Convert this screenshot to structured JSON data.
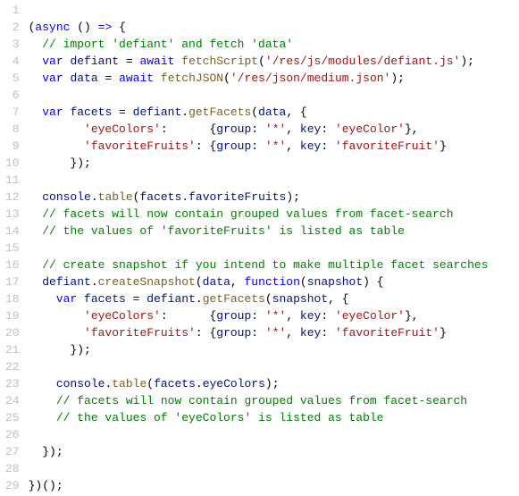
{
  "lines": [
    {
      "num": "1",
      "tokens": []
    },
    {
      "num": "2",
      "tokens": [
        {
          "cls": "pun",
          "t": "("
        },
        {
          "cls": "kw",
          "t": "async"
        },
        {
          "cls": "pun",
          "t": " () "
        },
        {
          "cls": "kw",
          "t": "=>"
        },
        {
          "cls": "pun",
          "t": " {"
        }
      ]
    },
    {
      "num": "3",
      "tokens": [
        {
          "cls": "pun",
          "t": "  "
        },
        {
          "cls": "com",
          "t": "// import 'defiant' and fetch 'data'"
        }
      ]
    },
    {
      "num": "4",
      "tokens": [
        {
          "cls": "pun",
          "t": "  "
        },
        {
          "cls": "kw",
          "t": "var"
        },
        {
          "cls": "pun",
          "t": " "
        },
        {
          "cls": "ident",
          "t": "defiant"
        },
        {
          "cls": "pun",
          "t": " = "
        },
        {
          "cls": "kw",
          "t": "await"
        },
        {
          "cls": "pun",
          "t": " "
        },
        {
          "cls": "fn",
          "t": "fetchScript"
        },
        {
          "cls": "pun",
          "t": "("
        },
        {
          "cls": "str",
          "t": "'/res/js/modules/defiant.js'"
        },
        {
          "cls": "pun",
          "t": ");"
        }
      ]
    },
    {
      "num": "5",
      "tokens": [
        {
          "cls": "pun",
          "t": "  "
        },
        {
          "cls": "kw",
          "t": "var"
        },
        {
          "cls": "pun",
          "t": " "
        },
        {
          "cls": "ident",
          "t": "data"
        },
        {
          "cls": "pun",
          "t": " = "
        },
        {
          "cls": "kw",
          "t": "await"
        },
        {
          "cls": "pun",
          "t": " "
        },
        {
          "cls": "fn",
          "t": "fetchJSON"
        },
        {
          "cls": "pun",
          "t": "("
        },
        {
          "cls": "str",
          "t": "'/res/json/medium.json'"
        },
        {
          "cls": "pun",
          "t": ");"
        }
      ]
    },
    {
      "num": "6",
      "tokens": []
    },
    {
      "num": "7",
      "tokens": [
        {
          "cls": "pun",
          "t": "  "
        },
        {
          "cls": "kw",
          "t": "var"
        },
        {
          "cls": "pun",
          "t": " "
        },
        {
          "cls": "ident",
          "t": "facets"
        },
        {
          "cls": "pun",
          "t": " = "
        },
        {
          "cls": "ident",
          "t": "defiant"
        },
        {
          "cls": "pun",
          "t": "."
        },
        {
          "cls": "fn",
          "t": "getFacets"
        },
        {
          "cls": "pun",
          "t": "("
        },
        {
          "cls": "ident",
          "t": "data"
        },
        {
          "cls": "pun",
          "t": ", {"
        }
      ]
    },
    {
      "num": "8",
      "tokens": [
        {
          "cls": "pun",
          "t": "        "
        },
        {
          "cls": "str",
          "t": "'eyeColors'"
        },
        {
          "cls": "pun",
          "t": ":      {"
        },
        {
          "cls": "prop",
          "t": "group"
        },
        {
          "cls": "pun",
          "t": ": "
        },
        {
          "cls": "str",
          "t": "'*'"
        },
        {
          "cls": "pun",
          "t": ", "
        },
        {
          "cls": "prop",
          "t": "key"
        },
        {
          "cls": "pun",
          "t": ": "
        },
        {
          "cls": "str",
          "t": "'eyeColor'"
        },
        {
          "cls": "pun",
          "t": "},"
        }
      ]
    },
    {
      "num": "9",
      "tokens": [
        {
          "cls": "pun",
          "t": "        "
        },
        {
          "cls": "str",
          "t": "'favoriteFruits'"
        },
        {
          "cls": "pun",
          "t": ": {"
        },
        {
          "cls": "prop",
          "t": "group"
        },
        {
          "cls": "pun",
          "t": ": "
        },
        {
          "cls": "str",
          "t": "'*'"
        },
        {
          "cls": "pun",
          "t": ", "
        },
        {
          "cls": "prop",
          "t": "key"
        },
        {
          "cls": "pun",
          "t": ": "
        },
        {
          "cls": "str",
          "t": "'favoriteFruit'"
        },
        {
          "cls": "pun",
          "t": "}"
        }
      ]
    },
    {
      "num": "10",
      "tokens": [
        {
          "cls": "pun",
          "t": "      });"
        }
      ]
    },
    {
      "num": "11",
      "tokens": []
    },
    {
      "num": "12",
      "tokens": [
        {
          "cls": "pun",
          "t": "  "
        },
        {
          "cls": "ident",
          "t": "console"
        },
        {
          "cls": "pun",
          "t": "."
        },
        {
          "cls": "fn",
          "t": "table"
        },
        {
          "cls": "pun",
          "t": "("
        },
        {
          "cls": "ident",
          "t": "facets"
        },
        {
          "cls": "pun",
          "t": "."
        },
        {
          "cls": "prop",
          "t": "favoriteFruits"
        },
        {
          "cls": "pun",
          "t": ");"
        }
      ]
    },
    {
      "num": "13",
      "tokens": [
        {
          "cls": "pun",
          "t": "  "
        },
        {
          "cls": "com",
          "t": "// facets will now contain grouped values from facet-search"
        }
      ]
    },
    {
      "num": "14",
      "tokens": [
        {
          "cls": "pun",
          "t": "  "
        },
        {
          "cls": "com",
          "t": "// the values of 'favoriteFruits' is listed as table"
        }
      ]
    },
    {
      "num": "15",
      "tokens": []
    },
    {
      "num": "16",
      "tokens": [
        {
          "cls": "pun",
          "t": "  "
        },
        {
          "cls": "com",
          "t": "// create snapshot if you intend to make multiple facet searches"
        }
      ]
    },
    {
      "num": "17",
      "tokens": [
        {
          "cls": "pun",
          "t": "  "
        },
        {
          "cls": "ident",
          "t": "defiant"
        },
        {
          "cls": "pun",
          "t": "."
        },
        {
          "cls": "fn",
          "t": "createSnapshot"
        },
        {
          "cls": "pun",
          "t": "("
        },
        {
          "cls": "ident",
          "t": "data"
        },
        {
          "cls": "pun",
          "t": ", "
        },
        {
          "cls": "kw",
          "t": "function"
        },
        {
          "cls": "pun",
          "t": "("
        },
        {
          "cls": "ident",
          "t": "snapshot"
        },
        {
          "cls": "pun",
          "t": ") {"
        }
      ]
    },
    {
      "num": "18",
      "tokens": [
        {
          "cls": "pun",
          "t": "    "
        },
        {
          "cls": "kw",
          "t": "var"
        },
        {
          "cls": "pun",
          "t": " "
        },
        {
          "cls": "ident",
          "t": "facets"
        },
        {
          "cls": "pun",
          "t": " = "
        },
        {
          "cls": "ident",
          "t": "defiant"
        },
        {
          "cls": "pun",
          "t": "."
        },
        {
          "cls": "fn",
          "t": "getFacets"
        },
        {
          "cls": "pun",
          "t": "("
        },
        {
          "cls": "ident",
          "t": "snapshot"
        },
        {
          "cls": "pun",
          "t": ", {"
        }
      ]
    },
    {
      "num": "19",
      "tokens": [
        {
          "cls": "pun",
          "t": "        "
        },
        {
          "cls": "str",
          "t": "'eyeColors'"
        },
        {
          "cls": "pun",
          "t": ":      {"
        },
        {
          "cls": "prop",
          "t": "group"
        },
        {
          "cls": "pun",
          "t": ": "
        },
        {
          "cls": "str",
          "t": "'*'"
        },
        {
          "cls": "pun",
          "t": ", "
        },
        {
          "cls": "prop",
          "t": "key"
        },
        {
          "cls": "pun",
          "t": ": "
        },
        {
          "cls": "str",
          "t": "'eyeColor'"
        },
        {
          "cls": "pun",
          "t": "},"
        }
      ]
    },
    {
      "num": "20",
      "tokens": [
        {
          "cls": "pun",
          "t": "        "
        },
        {
          "cls": "str",
          "t": "'favoriteFruits'"
        },
        {
          "cls": "pun",
          "t": ": {"
        },
        {
          "cls": "prop",
          "t": "group"
        },
        {
          "cls": "pun",
          "t": ": "
        },
        {
          "cls": "str",
          "t": "'*'"
        },
        {
          "cls": "pun",
          "t": ", "
        },
        {
          "cls": "prop",
          "t": "key"
        },
        {
          "cls": "pun",
          "t": ": "
        },
        {
          "cls": "str",
          "t": "'favoriteFruit'"
        },
        {
          "cls": "pun",
          "t": "}"
        }
      ]
    },
    {
      "num": "21",
      "tokens": [
        {
          "cls": "pun",
          "t": "      });"
        }
      ]
    },
    {
      "num": "22",
      "tokens": []
    },
    {
      "num": "23",
      "tokens": [
        {
          "cls": "pun",
          "t": "    "
        },
        {
          "cls": "ident",
          "t": "console"
        },
        {
          "cls": "pun",
          "t": "."
        },
        {
          "cls": "fn",
          "t": "table"
        },
        {
          "cls": "pun",
          "t": "("
        },
        {
          "cls": "ident",
          "t": "facets"
        },
        {
          "cls": "pun",
          "t": "."
        },
        {
          "cls": "prop",
          "t": "eyeColors"
        },
        {
          "cls": "pun",
          "t": ");"
        }
      ]
    },
    {
      "num": "24",
      "tokens": [
        {
          "cls": "pun",
          "t": "    "
        },
        {
          "cls": "com",
          "t": "// facets will now contain grouped values from facet-search"
        }
      ]
    },
    {
      "num": "25",
      "tokens": [
        {
          "cls": "pun",
          "t": "    "
        },
        {
          "cls": "com",
          "t": "// the values of 'eyeColors' is listed as table"
        }
      ]
    },
    {
      "num": "26",
      "tokens": []
    },
    {
      "num": "27",
      "tokens": [
        {
          "cls": "pun",
          "t": "  });"
        }
      ]
    },
    {
      "num": "28",
      "tokens": []
    },
    {
      "num": "29",
      "tokens": [
        {
          "cls": "pun",
          "t": "})();"
        }
      ]
    }
  ]
}
